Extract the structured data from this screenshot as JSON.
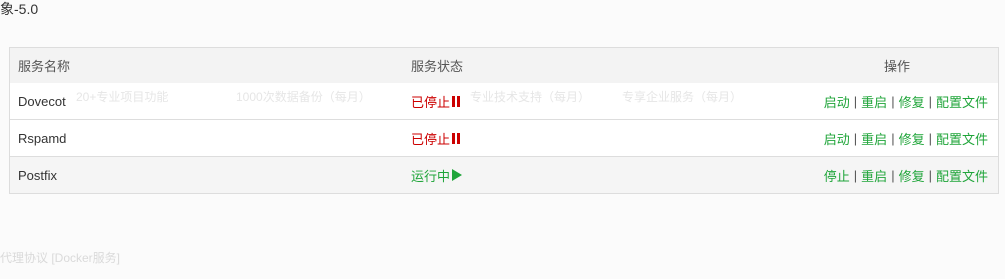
{
  "top_title": "象-5.0",
  "table": {
    "headers": {
      "name": "服务名称",
      "status": "服务状态",
      "ops": "操作"
    },
    "rows": [
      {
        "name": "Dovecot",
        "status": "已停止",
        "status_kind": "stopped",
        "ops": [
          "启动",
          "重启",
          "修复",
          "配置文件"
        ]
      },
      {
        "name": "Rspamd",
        "status": "已停止",
        "status_kind": "stopped",
        "ops": [
          "启动",
          "重启",
          "修复",
          "配置文件"
        ]
      },
      {
        "name": "Postfix",
        "status": "运行中",
        "status_kind": "running",
        "ops": [
          "停止",
          "重启",
          "修复",
          "配置文件"
        ]
      }
    ]
  },
  "colors": {
    "stopped": "#cc0000",
    "running": "#20a53a",
    "link": "#20a53a"
  },
  "icons": {
    "stopped": "pause-icon",
    "running": "play-icon"
  },
  "background_faint": {
    "strip": [
      "20+专业项目功能",
      "1000次数据备份（每月）",
      "专业技术支持（每月）",
      "专享企业服务（每月）"
    ],
    "bottom": "代理协议 [Docker服务]"
  }
}
